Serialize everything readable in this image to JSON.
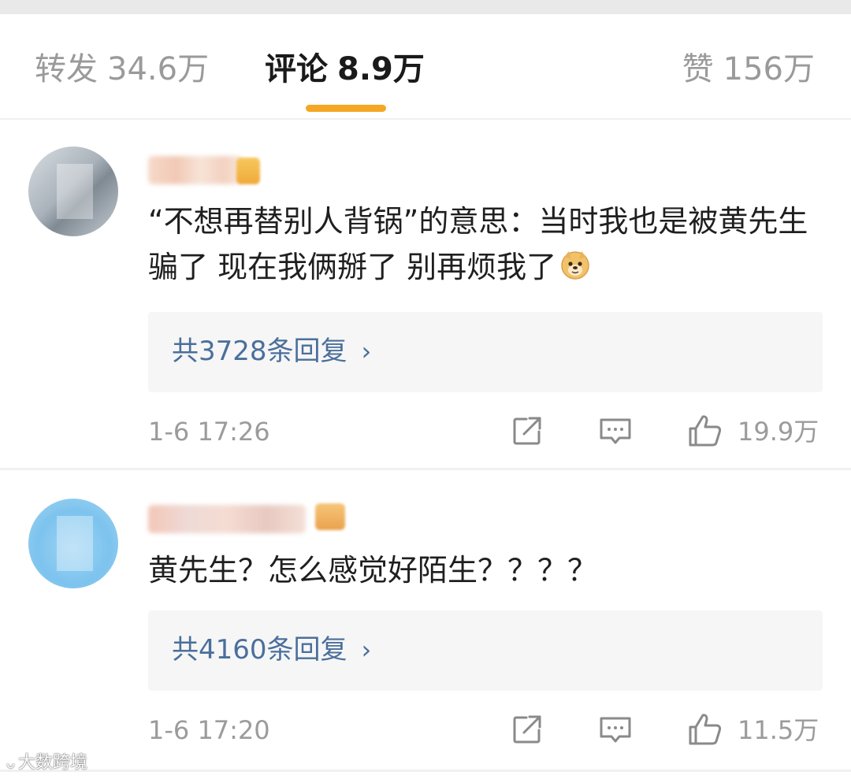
{
  "tabs": {
    "reposts": {
      "label": "转发",
      "count": "34.6万"
    },
    "comments": {
      "label": "评论",
      "count": "8.9万"
    },
    "likes": {
      "label": "赞",
      "count": "156万"
    }
  },
  "accent_color": "#f5a623",
  "link_color": "#4a6f9c",
  "comments": [
    {
      "text": "“不想再替别人背锅”的意思：当时我也是被黄先生骗了 现在我俩掰了 别再烦我了",
      "emoji": "doge-emoji",
      "replies_label": "共3728条回复",
      "timestamp": "1-6 17:26",
      "likes": "19.9万"
    },
    {
      "text": "黄先生？怎么感觉好陌生？？？？",
      "replies_label": "共4160条回复",
      "timestamp": "1-6 17:20",
      "likes": "11.5万"
    }
  ],
  "icons": {
    "share": "share-icon",
    "reply": "comment-icon",
    "like": "thumbs-up-icon",
    "chevron": "chevron-right-icon"
  },
  "chevron_glyph": "›",
  "watermark": {
    "text": "大数跨境"
  }
}
